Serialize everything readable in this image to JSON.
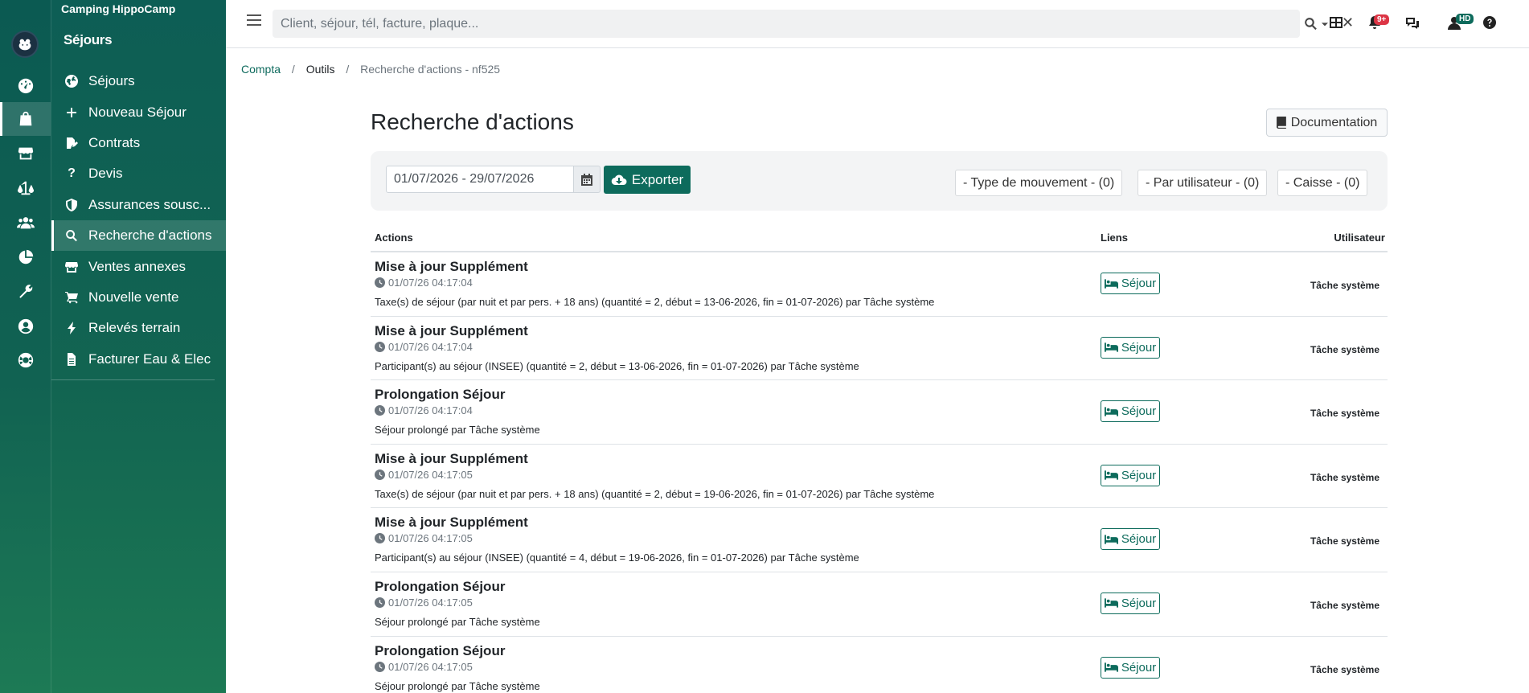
{
  "sidebar": {
    "camp_name": "Camping HippoCamp",
    "section_title": "Séjours",
    "rail_icons": [
      "dashboard-icon",
      "bag-icon",
      "store-icon",
      "scale-icon",
      "users-icon",
      "pie-chart-icon",
      "wrench-icon",
      "user-circle-icon",
      "lifebuoy-icon"
    ],
    "items": [
      {
        "label": "Séjours",
        "icon": "globe-icon"
      },
      {
        "label": "Nouveau Séjour",
        "icon": "plus-icon"
      },
      {
        "label": "Contrats",
        "icon": "file-signature-icon"
      },
      {
        "label": "Devis",
        "icon": "question-icon"
      },
      {
        "label": "Assurances sousc...",
        "icon": "shield-icon"
      },
      {
        "label": "Recherche d'actions",
        "icon": "search-icon"
      },
      {
        "label": "Ventes annexes",
        "icon": "store-icon"
      },
      {
        "label": "Nouvelle vente",
        "icon": "cart-icon"
      },
      {
        "label": "Relevés terrain",
        "icon": "bolt-icon"
      },
      {
        "label": "Facturer Eau & Elec",
        "icon": "file-icon"
      }
    ]
  },
  "topbar": {
    "search_placeholder": "Client, séjour, tél, facture, plaque...",
    "notif_badge": "9+",
    "user_badge": "HD"
  },
  "breadcrumb": {
    "items": [
      "Compta",
      "Outils",
      "Recherche d'actions - nf525"
    ]
  },
  "page": {
    "title": "Recherche d'actions",
    "doc_button": "Documentation"
  },
  "filters": {
    "date_range": "01/07/2026 - 29/07/2026",
    "export_label": "Exporter",
    "type_filter": "- Type de mouvement - (0)",
    "user_filter": "- Par utilisateur - (0)",
    "cash_filter": "- Caisse - (0)"
  },
  "table": {
    "headers": {
      "actions": "Actions",
      "links": "Liens",
      "user": "Utilisateur"
    },
    "rows": [
      {
        "title": "Mise à jour Supplément",
        "time": "01/07/26 04:17:04",
        "desc": "Taxe(s) de séjour (par nuit et par pers. + 18 ans) (quantité = 2, début = 13-06-2026, fin = 01-07-2026) par Tâche système",
        "link": "Séjour",
        "user": "Tâche système"
      },
      {
        "title": "Mise à jour Supplément",
        "time": "01/07/26 04:17:04",
        "desc": "Participant(s) au séjour (INSEE) (quantité = 2, début = 13-06-2026, fin = 01-07-2026) par Tâche système",
        "link": "Séjour",
        "user": "Tâche système"
      },
      {
        "title": "Prolongation Séjour",
        "time": "01/07/26 04:17:04",
        "desc": "Séjour prolongé par Tâche système",
        "link": "Séjour",
        "user": "Tâche système"
      },
      {
        "title": "Mise à jour Supplément",
        "time": "01/07/26 04:17:05",
        "desc": "Taxe(s) de séjour (par nuit et par pers. + 18 ans) (quantité = 2, début = 19-06-2026, fin = 01-07-2026) par Tâche système",
        "link": "Séjour",
        "user": "Tâche système"
      },
      {
        "title": "Mise à jour Supplément",
        "time": "01/07/26 04:17:05",
        "desc": "Participant(s) au séjour (INSEE) (quantité = 4, début = 19-06-2026, fin = 01-07-2026) par Tâche système",
        "link": "Séjour",
        "user": "Tâche système"
      },
      {
        "title": "Prolongation Séjour",
        "time": "01/07/26 04:17:05",
        "desc": "Séjour prolongé par Tâche système",
        "link": "Séjour",
        "user": "Tâche système"
      },
      {
        "title": "Prolongation Séjour",
        "time": "01/07/26 04:17:05",
        "desc": "Séjour prolongé par Tâche système",
        "link": "Séjour",
        "user": "Tâche système"
      }
    ]
  },
  "colors": {
    "brand": "#0d6b5c",
    "notif_badge": "#dc3545",
    "user_badge": "#0d6b5c"
  }
}
